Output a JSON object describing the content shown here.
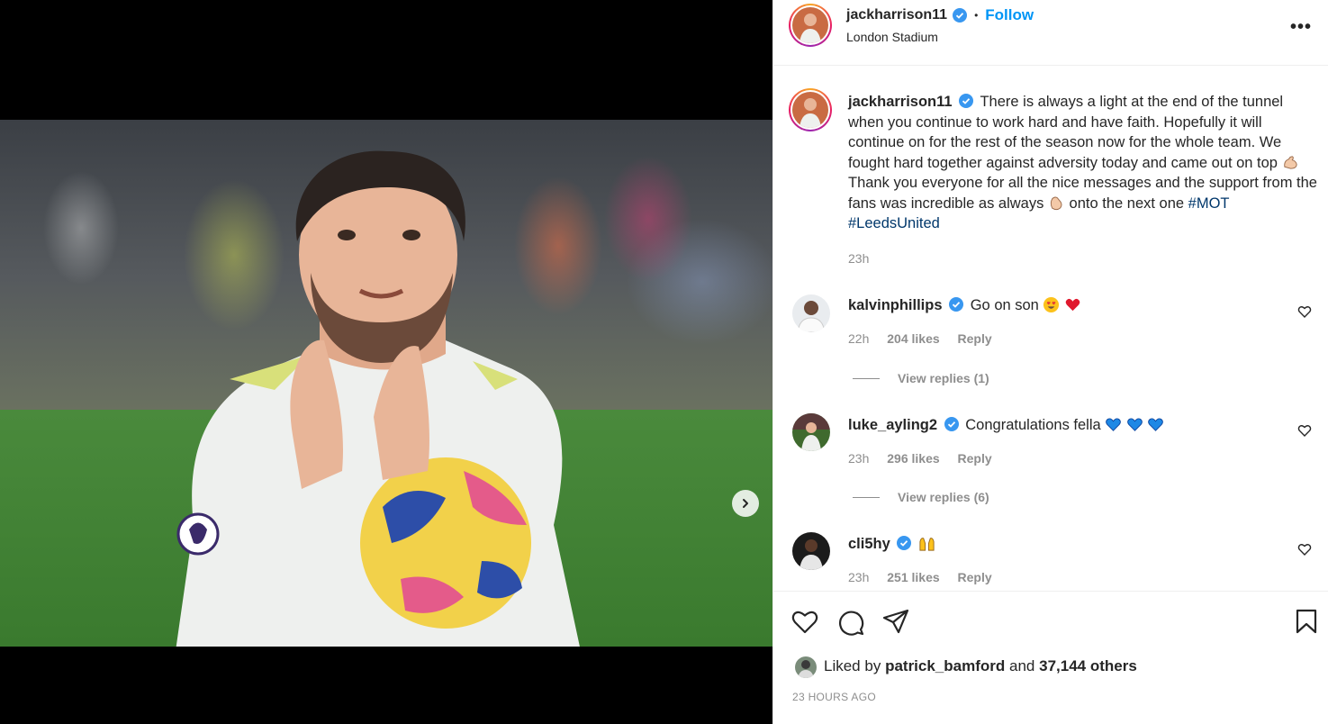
{
  "post": {
    "author": "jackharrison11",
    "follow_label": "Follow",
    "separator": "•",
    "location": "London Stadium",
    "more_label": "•••"
  },
  "caption": {
    "username": "jackharrison11",
    "text_1": "There is always a light at the end of the tunnel when you continue to work hard and have faith. Hopefully it will continue on for the rest of the season now for the whole team. We fought hard together against adversity today and came out on top",
    "text_2": "Thank you everyone for all the nice messages and the support from the fans was incredible as always",
    "text_3": "onto the next one",
    "hashtag_1": "#MOT",
    "hashtag_2": "#LeedsUnited",
    "time": "23h"
  },
  "comments": [
    {
      "username": "kalvinphillips",
      "text": "Go on son",
      "time": "22h",
      "likes": "204 likes",
      "reply": "Reply",
      "view_replies": "View replies (1)"
    },
    {
      "username": "luke_ayling2",
      "text": "Congratulations fella",
      "time": "23h",
      "likes": "296 likes",
      "reply": "Reply",
      "view_replies": "View replies (6)"
    },
    {
      "username": "cli5hy",
      "text": "",
      "time": "23h",
      "likes": "251 likes",
      "reply": "Reply"
    }
  ],
  "footer": {
    "liked_by_prefix": "Liked by",
    "liked_by_user": "patrick_bamford",
    "liked_by_and": "and",
    "liked_by_count": "37,144 others",
    "timestamp": "23 HOURS AGO"
  },
  "carousel": {
    "total": 3,
    "active": 1
  },
  "colors": {
    "accent": "#0095f6",
    "hashtag": "#00376b",
    "muted": "#8e8e8e",
    "verified": "#3897f0"
  }
}
